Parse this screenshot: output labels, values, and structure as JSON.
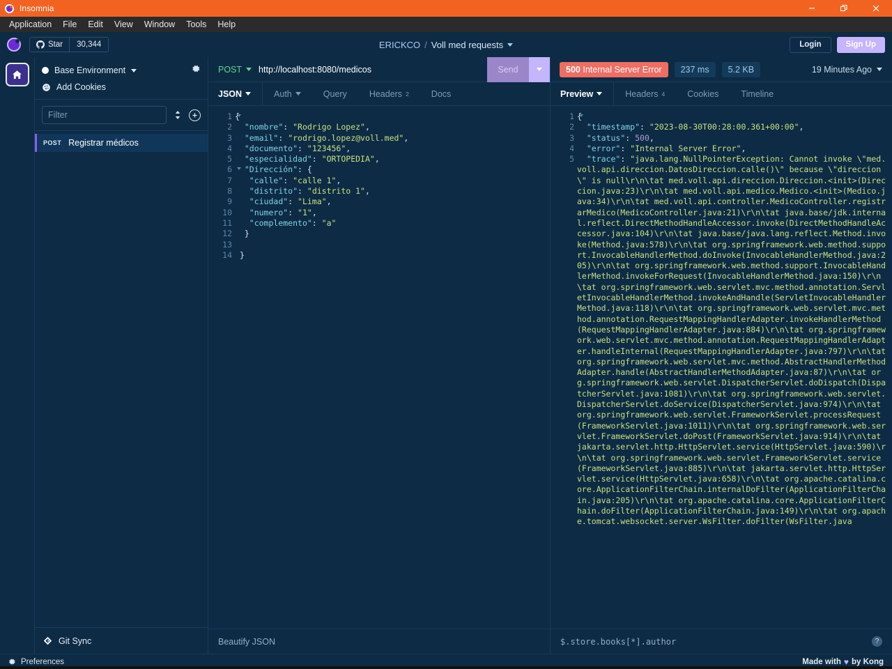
{
  "window": {
    "title": "Insomnia",
    "controls": {
      "minimize": "minimize-icon",
      "restore": "restore-icon",
      "close": "close-icon"
    }
  },
  "menubar": {
    "items": [
      "Application",
      "File",
      "Edit",
      "View",
      "Window",
      "Tools",
      "Help"
    ]
  },
  "orgbar": {
    "star_label": "Star",
    "star_count": "30,344",
    "breadcrumb_org": "ERICKCO",
    "breadcrumb_sep": "/",
    "breadcrumb_project": "Voll med requests",
    "login_label": "Login",
    "signup_label": "Sign Up"
  },
  "sidebar": {
    "environment": "Base Environment",
    "cookies": "Add Cookies",
    "filter_placeholder": "Filter",
    "filter_value": "",
    "requests": [
      {
        "method": "POST",
        "name": "Registrar médicos",
        "active": true
      }
    ],
    "git_sync": "Git Sync"
  },
  "request": {
    "method": "POST",
    "url": "http://localhost:8080/medicos",
    "send_label": "Send",
    "tabs": [
      {
        "label": "JSON",
        "caret": true,
        "active": true,
        "badge": ""
      },
      {
        "label": "Auth",
        "caret": true,
        "active": false,
        "badge": ""
      },
      {
        "label": "Query",
        "caret": false,
        "active": false,
        "badge": ""
      },
      {
        "label": "Headers",
        "caret": false,
        "active": false,
        "badge": "2"
      },
      {
        "label": "Docs",
        "caret": false,
        "active": false,
        "badge": ""
      }
    ],
    "beautify_label": "Beautify JSON",
    "body_lines": [
      {
        "n": 1,
        "fold": true,
        "tokens": [
          [
            "p",
            "{"
          ]
        ]
      },
      {
        "n": 2,
        "fold": false,
        "tokens": [
          [
            "p",
            "  "
          ],
          [
            "k",
            "\"nombre\""
          ],
          [
            "p",
            ": "
          ],
          [
            "s",
            "\"Rodrigo Lopez\""
          ],
          [
            "p",
            ","
          ]
        ]
      },
      {
        "n": 3,
        "fold": false,
        "tokens": [
          [
            "p",
            "  "
          ],
          [
            "k",
            "\"email\""
          ],
          [
            "p",
            ": "
          ],
          [
            "s",
            "\"rodrigo.lopez@voll.med\""
          ],
          [
            "p",
            ","
          ]
        ]
      },
      {
        "n": 4,
        "fold": false,
        "tokens": [
          [
            "p",
            "  "
          ],
          [
            "k",
            "\"documento\""
          ],
          [
            "p",
            ": "
          ],
          [
            "s",
            "\"123456\""
          ],
          [
            "p",
            ","
          ]
        ]
      },
      {
        "n": 5,
        "fold": false,
        "tokens": [
          [
            "p",
            "  "
          ],
          [
            "k",
            "\"especialidad\""
          ],
          [
            "p",
            ": "
          ],
          [
            "s",
            "\"ORTOPEDIA\""
          ],
          [
            "p",
            ","
          ]
        ]
      },
      {
        "n": 6,
        "fold": true,
        "tokens": [
          [
            "p",
            "  "
          ],
          [
            "k",
            "\"Dirección\""
          ],
          [
            "p",
            ": {"
          ]
        ]
      },
      {
        "n": 7,
        "fold": false,
        "tokens": [
          [
            "p",
            "   "
          ],
          [
            "k",
            "\"calle\""
          ],
          [
            "p",
            ": "
          ],
          [
            "s",
            "\"calle 1\""
          ],
          [
            "p",
            ","
          ]
        ]
      },
      {
        "n": 8,
        "fold": false,
        "tokens": [
          [
            "p",
            "   "
          ],
          [
            "k",
            "\"distrito\""
          ],
          [
            "p",
            ": "
          ],
          [
            "s",
            "\"distrito 1\""
          ],
          [
            "p",
            ","
          ]
        ]
      },
      {
        "n": 9,
        "fold": false,
        "tokens": [
          [
            "p",
            "   "
          ],
          [
            "k",
            "\"ciudad\""
          ],
          [
            "p",
            ": "
          ],
          [
            "s",
            "\"Lima\""
          ],
          [
            "p",
            ","
          ]
        ]
      },
      {
        "n": 10,
        "fold": false,
        "tokens": [
          [
            "p",
            "   "
          ],
          [
            "k",
            "\"numero\""
          ],
          [
            "p",
            ": "
          ],
          [
            "s",
            "\"1\""
          ],
          [
            "p",
            ","
          ]
        ]
      },
      {
        "n": 11,
        "fold": false,
        "tokens": [
          [
            "p",
            "   "
          ],
          [
            "k",
            "\"complemento\""
          ],
          [
            "p",
            ": "
          ],
          [
            "s",
            "\"a\""
          ]
        ]
      },
      {
        "n": 12,
        "fold": false,
        "tokens": [
          [
            "p",
            "  }"
          ]
        ]
      },
      {
        "n": 13,
        "fold": false,
        "tokens": [
          [
            "p",
            ""
          ]
        ]
      },
      {
        "n": 14,
        "fold": false,
        "tokens": [
          [
            "p",
            " }"
          ]
        ]
      }
    ]
  },
  "response": {
    "status_code": "500",
    "status_text": "Internal Server Error",
    "time": "237 ms",
    "size": "5.2 KB",
    "history": "19 Minutes Ago",
    "tabs": [
      {
        "label": "Preview",
        "caret": true,
        "active": true,
        "badge": ""
      },
      {
        "label": "Headers",
        "caret": false,
        "active": false,
        "badge": "4"
      },
      {
        "label": "Cookies",
        "caret": false,
        "active": false,
        "badge": ""
      },
      {
        "label": "Timeline",
        "caret": false,
        "active": false,
        "badge": ""
      }
    ],
    "jsonpath_placeholder": "$.store.books[*].author",
    "jsonpath_value": "",
    "help_label": "?",
    "body_lines": [
      {
        "n": 1,
        "fold": true,
        "tokens": [
          [
            "p",
            "{"
          ]
        ]
      },
      {
        "n": 2,
        "fold": false,
        "tokens": [
          [
            "p",
            "  "
          ],
          [
            "k",
            "\"timestamp\""
          ],
          [
            "p",
            ": "
          ],
          [
            "s",
            "\"2023-08-30T00:28:00.361+00:00\""
          ],
          [
            "p",
            ","
          ]
        ]
      },
      {
        "n": 3,
        "fold": false,
        "tokens": [
          [
            "p",
            "  "
          ],
          [
            "k",
            "\"status\""
          ],
          [
            "p",
            ": "
          ],
          [
            "n",
            "500"
          ],
          [
            "p",
            ","
          ]
        ]
      },
      {
        "n": 4,
        "fold": false,
        "tokens": [
          [
            "p",
            "  "
          ],
          [
            "k",
            "\"error\""
          ],
          [
            "p",
            ": "
          ],
          [
            "s",
            "\"Internal Server Error\""
          ],
          [
            "p",
            ","
          ]
        ]
      },
      {
        "n": 5,
        "fold": false,
        "tokens": [
          [
            "p",
            "  "
          ],
          [
            "k",
            "\"trace\""
          ],
          [
            "p",
            ": "
          ],
          [
            "s",
            "\"java.lang.NullPointerException: Cannot invoke \\\"med.voll.api.direccion.DatosDireccion.calle()\\\" because \\\"direccion\\\" is null\\r\\n\\tat med.voll.api.direccion.Direccion.<init>(Direccion.java:23)\\r\\n\\tat med.voll.api.medico.Medico.<init>(Medico.java:34)\\r\\n\\tat med.voll.api.controller.MedicoController.registrarMedico(MedicoController.java:21)\\r\\n\\tat java.base/jdk.internal.reflect.DirectMethodHandleAccessor.invoke(DirectMethodHandleAccessor.java:104)\\r\\n\\tat java.base/java.lang.reflect.Method.invoke(Method.java:578)\\r\\n\\tat org.springframework.web.method.support.InvocableHandlerMethod.doInvoke(InvocableHandlerMethod.java:205)\\r\\n\\tat org.springframework.web.method.support.InvocableHandlerMethod.invokeForRequest(InvocableHandlerMethod.java:150)\\r\\n\\tat org.springframework.web.servlet.mvc.method.annotation.ServletInvocableHandlerMethod.invokeAndHandle(ServletInvocableHandlerMethod.java:118)\\r\\n\\tat org.springframework.web.servlet.mvc.method.annotation.RequestMappingHandlerAdapter.invokeHandlerMethod(RequestMappingHandlerAdapter.java:884)\\r\\n\\tat org.springframework.web.servlet.mvc.method.annotation.RequestMappingHandlerAdapter.handleInternal(RequestMappingHandlerAdapter.java:797)\\r\\n\\tat org.springframework.web.servlet.mvc.method.AbstractHandlerMethodAdapter.handle(AbstractHandlerMethodAdapter.java:87)\\r\\n\\tat org.springframework.web.servlet.DispatcherServlet.doDispatch(DispatcherServlet.java:1081)\\r\\n\\tat org.springframework.web.servlet.DispatcherServlet.doService(DispatcherServlet.java:974)\\r\\n\\tat org.springframework.web.servlet.FrameworkServlet.processRequest(FrameworkServlet.java:1011)\\r\\n\\tat org.springframework.web.servlet.FrameworkServlet.doPost(FrameworkServlet.java:914)\\r\\n\\tat jakarta.servlet.http.HttpServlet.service(HttpServlet.java:590)\\r\\n\\tat org.springframework.web.servlet.FrameworkServlet.service(FrameworkServlet.java:885)\\r\\n\\tat jakarta.servlet.http.HttpServlet.service(HttpServlet.java:658)\\r\\n\\tat org.apache.catalina.core.ApplicationFilterChain.internalDoFilter(ApplicationFilterChain.java:205)\\r\\n\\tat org.apache.catalina.core.ApplicationFilterChain.doFilter(ApplicationFilterChain.java:149)\\r\\n\\tat org.apache.tomcat.websocket.server.WsFilter.doFilter(WsFilter.java"
          ]
        ]
      }
    ]
  },
  "statusbar": {
    "preferences": "Preferences",
    "made_with_prefix": "Made with",
    "heart": "♥",
    "made_with_suffix": "by Kong"
  },
  "colors": {
    "titlebar": "#f26322",
    "menubar": "#2b2b2b",
    "background": "#0d2b45",
    "accent_purple": "#c4b5fd",
    "error_red": "#ef6d62",
    "method_green": "#5fd68a",
    "json_key": "#7fd4e8",
    "json_string": "#c9e07f",
    "json_number": "#b39ddb"
  }
}
